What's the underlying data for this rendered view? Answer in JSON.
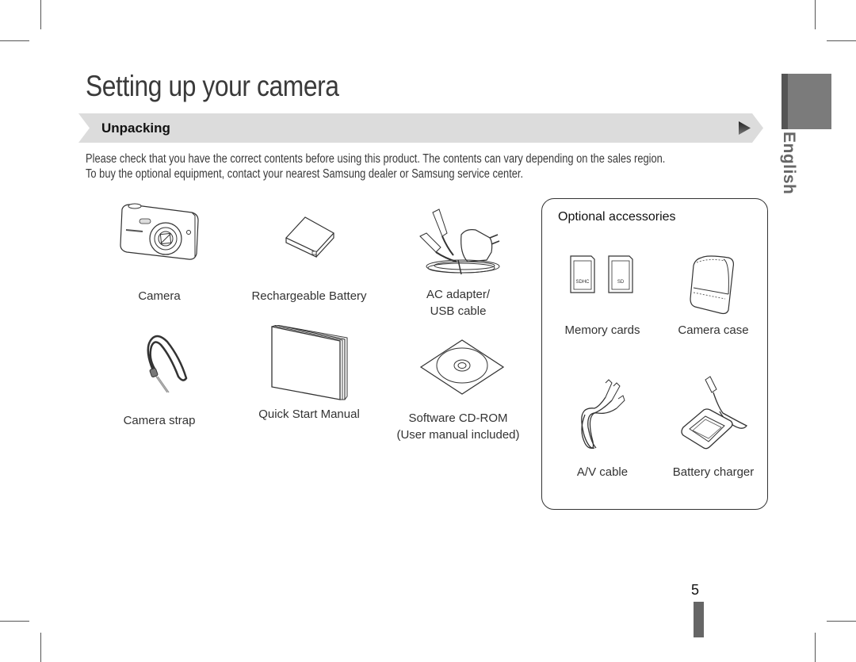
{
  "page": {
    "title": "Setting up your camera",
    "section": {
      "label": "Unpacking",
      "arrow_icon": "play-triangle-icon"
    },
    "intro_lines": [
      "Please check that you have the correct contents before using this product. The contents can vary depending on the sales region.",
      "To buy the optional equipment, contact your nearest Samsung dealer or Samsung service center."
    ],
    "included_items": [
      {
        "icon": "camera-icon",
        "label_lines": [
          "Camera"
        ]
      },
      {
        "icon": "battery-icon",
        "label_lines": [
          "Rechargeable Battery"
        ]
      },
      {
        "icon": "ac-adapter-icon",
        "label_lines": [
          "AC adapter/",
          "USB cable"
        ]
      },
      {
        "icon": "camera-strap-icon",
        "label_lines": [
          "Camera strap"
        ]
      },
      {
        "icon": "manual-icon",
        "label_lines": [
          "Quick Start Manual"
        ]
      },
      {
        "icon": "cd-rom-icon",
        "label_lines": [
          "Software CD-ROM",
          "(User manual included)"
        ]
      }
    ],
    "optional": {
      "title": "Optional accessories",
      "items": [
        {
          "icon": "memory-cards-icon",
          "label": "Memory cards",
          "card_labels": [
            "SDHC",
            "SD"
          ]
        },
        {
          "icon": "camera-case-icon",
          "label": "Camera case"
        },
        {
          "icon": "av-cable-icon",
          "label": "A/V cable"
        },
        {
          "icon": "battery-charger-icon",
          "label": "Battery charger"
        }
      ]
    },
    "side_tab": {
      "language": "English"
    },
    "page_number": "5"
  }
}
